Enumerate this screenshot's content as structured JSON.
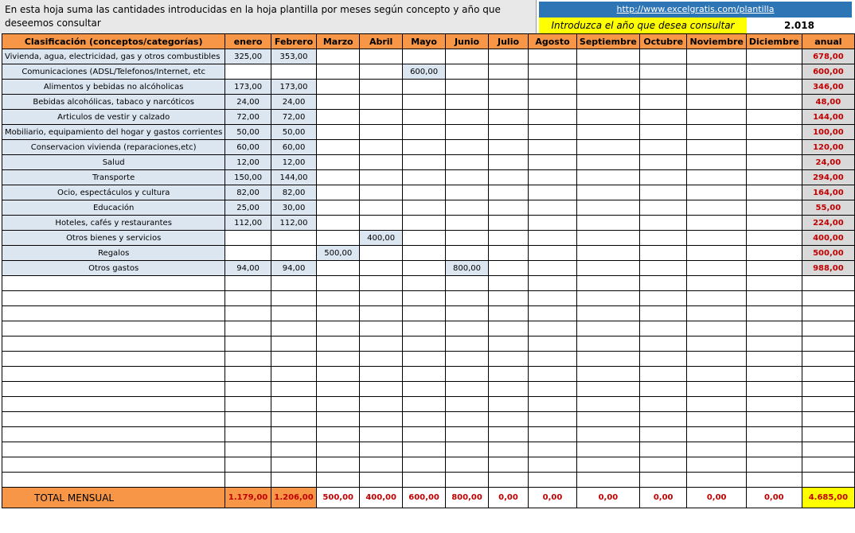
{
  "header": {
    "description": "En esta hoja suma las cantidades introducidas en la hoja plantilla por meses según concepto y año que deseemos consultar",
    "link_text": "http://www.excelgratis.com/plantilla",
    "year_prompt": "Introduzca el año que desea consultar",
    "year_value": "2.018"
  },
  "columns": [
    "Clasificación (conceptos/categorías)",
    "enero",
    "Febrero",
    "Marzo",
    "Abril",
    "Mayo",
    "Junio",
    "Julio",
    "Agosto",
    "Septiembre",
    "Octubre",
    "Noviembre",
    "Diciembre",
    "anual"
  ],
  "rows": [
    {
      "label": "Vivienda, agua, electricidad, gas y otros combustibles",
      "values": [
        "325,00",
        "353,00",
        "",
        "",
        "",
        "",
        "",
        "",
        "",
        "",
        "",
        ""
      ],
      "anual": "678,00"
    },
    {
      "label": "Comunicaciones  (ADSL/Telefonos/Internet, etc",
      "values": [
        "",
        "",
        "",
        "",
        "600,00",
        "",
        "",
        "",
        "",
        "",
        "",
        ""
      ],
      "anual": "600,00"
    },
    {
      "label": "Alimentos y bebidas no alcóholicas",
      "values": [
        "173,00",
        "173,00",
        "",
        "",
        "",
        "",
        "",
        "",
        "",
        "",
        "",
        ""
      ],
      "anual": "346,00"
    },
    {
      "label": "Bebidas alcohólicas, tabaco y narcóticos",
      "values": [
        "24,00",
        "24,00",
        "",
        "",
        "",
        "",
        "",
        "",
        "",
        "",
        "",
        ""
      ],
      "anual": "48,00"
    },
    {
      "label": "Articulos de vestir y calzado",
      "values": [
        "72,00",
        "72,00",
        "",
        "",
        "",
        "",
        "",
        "",
        "",
        "",
        "",
        ""
      ],
      "anual": "144,00"
    },
    {
      "label": "Mobiliario, equipamiento del hogar y gastos corrientes",
      "values": [
        "50,00",
        "50,00",
        "",
        "",
        "",
        "",
        "",
        "",
        "",
        "",
        "",
        ""
      ],
      "anual": "100,00"
    },
    {
      "label": "Conservacion vivienda (reparaciones,etc)",
      "values": [
        "60,00",
        "60,00",
        "",
        "",
        "",
        "",
        "",
        "",
        "",
        "",
        "",
        ""
      ],
      "anual": "120,00"
    },
    {
      "label": "Salud",
      "values": [
        "12,00",
        "12,00",
        "",
        "",
        "",
        "",
        "",
        "",
        "",
        "",
        "",
        ""
      ],
      "anual": "24,00"
    },
    {
      "label": "Transporte",
      "values": [
        "150,00",
        "144,00",
        "",
        "",
        "",
        "",
        "",
        "",
        "",
        "",
        "",
        ""
      ],
      "anual": "294,00"
    },
    {
      "label": "Ocio, espectáculos y cultura",
      "values": [
        "82,00",
        "82,00",
        "",
        "",
        "",
        "",
        "",
        "",
        "",
        "",
        "",
        ""
      ],
      "anual": "164,00"
    },
    {
      "label": "Educación",
      "values": [
        "25,00",
        "30,00",
        "",
        "",
        "",
        "",
        "",
        "",
        "",
        "",
        "",
        ""
      ],
      "anual": "55,00"
    },
    {
      "label": "Hoteles, cafés y restaurantes",
      "values": [
        "112,00",
        "112,00",
        "",
        "",
        "",
        "",
        "",
        "",
        "",
        "",
        "",
        ""
      ],
      "anual": "224,00"
    },
    {
      "label": "Otros bienes y servicios",
      "values": [
        "",
        "",
        "",
        "400,00",
        "",
        "",
        "",
        "",
        "",
        "",
        "",
        ""
      ],
      "anual": "400,00"
    },
    {
      "label": "Regalos",
      "values": [
        "",
        "",
        "500,00",
        "",
        "",
        "",
        "",
        "",
        "",
        "",
        "",
        ""
      ],
      "anual": "500,00"
    },
    {
      "label": "Otros gastos",
      "values": [
        "94,00",
        "94,00",
        "",
        "",
        "",
        "800,00",
        "",
        "",
        "",
        "",
        "",
        ""
      ],
      "anual": "988,00"
    }
  ],
  "total": {
    "label": "TOTAL MENSUAL",
    "values": [
      "1.179,00",
      "1.206,00",
      "500,00",
      "400,00",
      "600,00",
      "800,00",
      "0,00",
      "0,00",
      "0,00",
      "0,00",
      "0,00",
      "0,00"
    ],
    "anual": "4.685,00"
  }
}
